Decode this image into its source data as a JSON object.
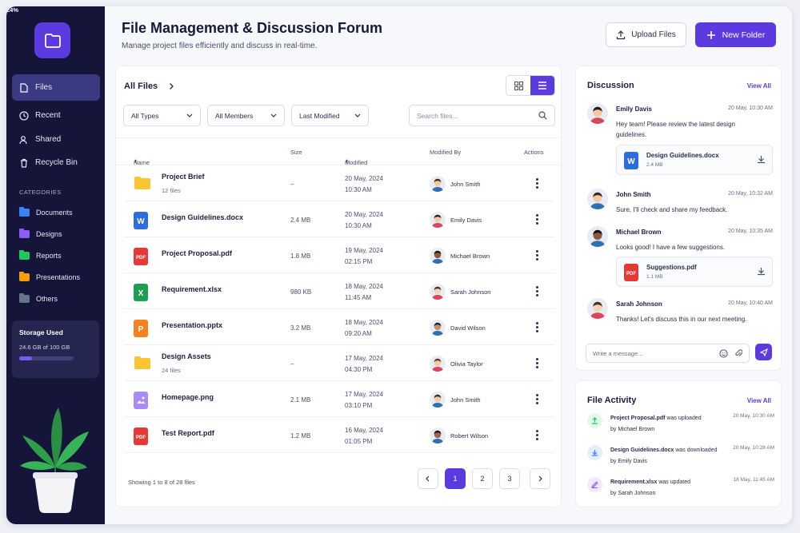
{
  "colors": {
    "accent": "#5b3be0",
    "sidebar": "#141539"
  },
  "sidebar": {
    "nav": [
      {
        "label": "Files",
        "icon": "file-icon",
        "active": true
      },
      {
        "label": "Recent",
        "icon": "clock-icon"
      },
      {
        "label": "Shared",
        "icon": "users-icon"
      },
      {
        "label": "Recycle Bin",
        "icon": "trash-icon"
      }
    ],
    "categories_title": "CATEGORIES",
    "categories": [
      {
        "label": "Documents",
        "color": "#3b82f6"
      },
      {
        "label": "Designs",
        "color": "#8b5cf6"
      },
      {
        "label": "Reports",
        "color": "#22c55e"
      },
      {
        "label": "Presentations",
        "color": "#f59e0b"
      },
      {
        "label": "Others",
        "color": "#64748b"
      }
    ],
    "storage": {
      "title": "Storage Used",
      "value": "24.6 GB of 100 GB",
      "percent_label": "24%",
      "percent": 24
    }
  },
  "header": {
    "title": "File Management & Discussion Forum",
    "subtitle": "Manage project files efficiently and discuss in real-time.",
    "upload_label": "Upload Files",
    "new_folder_label": "New Folder"
  },
  "files": {
    "heading": "All Files",
    "filters": [
      "All Types",
      "All Members",
      "Last Modified"
    ],
    "search_placeholder": "Search files...",
    "columns": {
      "name": "Name",
      "size": "Size",
      "modified": "Modified",
      "modified_by": "Modified By",
      "actions": "Actions"
    },
    "rows": [
      {
        "name": "Project Brief",
        "sub": "12 files",
        "type": "folder",
        "size": "–",
        "date": "20 May, 2024",
        "time": "10:30 AM",
        "by": "John Smith"
      },
      {
        "name": "Design Guidelines.docx",
        "sub": "",
        "type": "word",
        "size": "2.4 MB",
        "date": "20 May, 2024",
        "time": "10:30 AM",
        "by": "Emily Davis"
      },
      {
        "name": "Project Proposal.pdf",
        "sub": "",
        "type": "pdf",
        "size": "1.8 MB",
        "date": "19 May, 2024",
        "time": "02:15 PM",
        "by": "Michael Brown"
      },
      {
        "name": "Requirement.xlsx",
        "sub": "",
        "type": "excel",
        "size": "980 KB",
        "date": "18 May, 2024",
        "time": "11:45 AM",
        "by": "Sarah Johnson"
      },
      {
        "name": "Presentation.pptx",
        "sub": "",
        "type": "ppt",
        "size": "3.2 MB",
        "date": "18 May, 2024",
        "time": "09:20 AM",
        "by": "David Wilson"
      },
      {
        "name": "Design Assets",
        "sub": "24 files",
        "type": "folder",
        "size": "–",
        "date": "17 May, 2024",
        "time": "04:30 PM",
        "by": "Olivia Taylor"
      },
      {
        "name": "Homepage.png",
        "sub": "",
        "type": "image",
        "size": "2.1 MB",
        "date": "17 May, 2024",
        "time": "03:10 PM",
        "by": "John Smith"
      },
      {
        "name": "Test Report.pdf",
        "sub": "",
        "type": "pdf",
        "size": "1.2 MB",
        "date": "16 May, 2024",
        "time": "01:05 PM",
        "by": "Robert Wilson"
      }
    ],
    "showing": "Showing 1 to 8 of 28 files",
    "pages": [
      "1",
      "2",
      "3"
    ]
  },
  "discussion": {
    "heading": "Discussion",
    "view_all": "View All",
    "messages": [
      {
        "name": "Emily Davis",
        "time": "20 May, 10:30 AM",
        "text": "Hey team! Please review the latest design guidelines.",
        "attachment": {
          "name": "Design Guidelines.docx",
          "size": "2.4 MB",
          "type": "word"
        }
      },
      {
        "name": "John Smith",
        "time": "20 May, 10:32 AM",
        "text": "Sure, I'll check and share my feedback."
      },
      {
        "name": "Michael Brown",
        "time": "20 May, 10:35 AM",
        "text": "Looks good! I have a few suggestions.",
        "attachment": {
          "name": "Suggestions.pdf",
          "size": "1.1 MB",
          "type": "pdf"
        }
      },
      {
        "name": "Sarah Johnson",
        "time": "20 May, 10:40 AM",
        "text": "Thanks! Let's discuss this in our next meeting."
      }
    ],
    "compose_placeholder": "Write a message..."
  },
  "activity": {
    "heading": "File Activity",
    "view_all": "View All",
    "items": [
      {
        "file": "Project Proposal.pdf",
        "action": "was uploaded",
        "by": "by Michael Brown",
        "time": "20 May, 10:30 AM",
        "icon": "upload-icon",
        "color": "#22c55e"
      },
      {
        "file": "Design Guidelines.docx",
        "action": "was downloaded",
        "by": "by Emily Davis",
        "time": "20 May, 10:28 AM",
        "icon": "download-icon",
        "color": "#3b82f6"
      },
      {
        "file": "Requirement.xlsx",
        "action": "was updated",
        "by": "by Sarah Johnson",
        "time": "18 May, 11:45 AM",
        "icon": "pencil-icon",
        "color": "#8b5cf6"
      }
    ]
  }
}
